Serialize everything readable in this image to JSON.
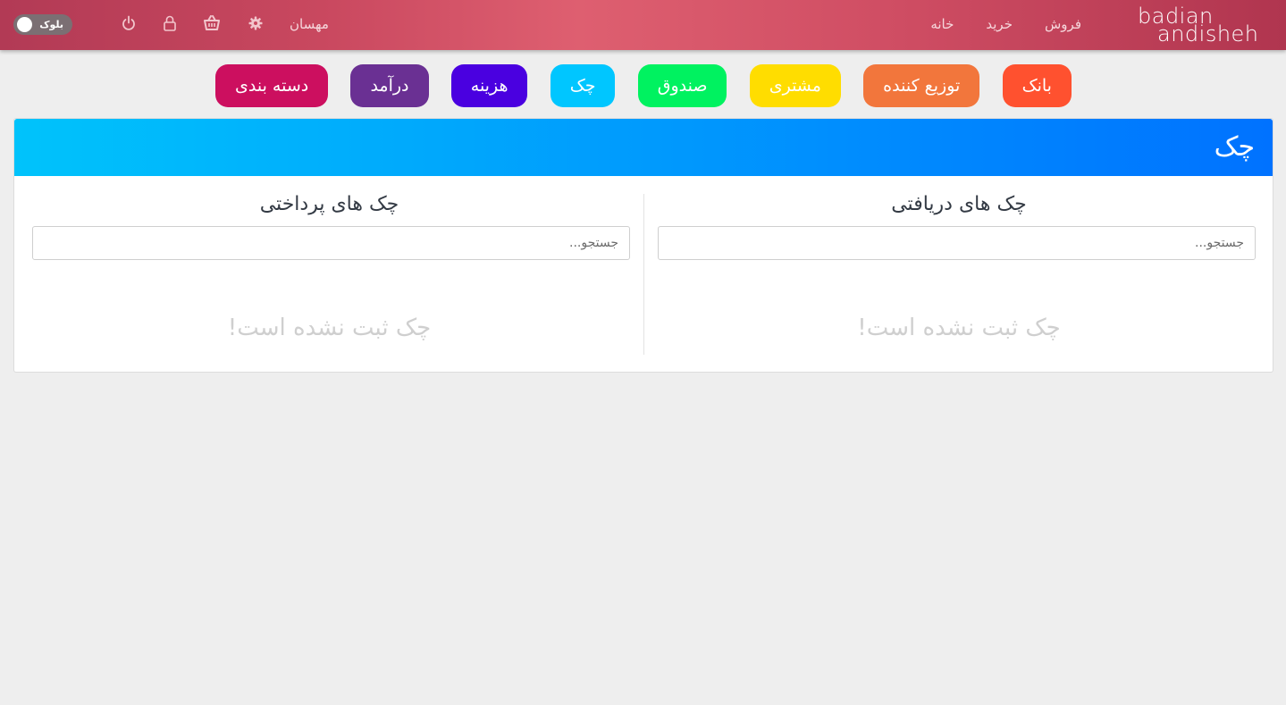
{
  "header": {
    "logo_line1": "badian",
    "logo_line2": "andisheh",
    "nav": [
      {
        "label": "خانه"
      },
      {
        "label": "خرید"
      },
      {
        "label": "فروش"
      }
    ],
    "guest_label": "مهسان",
    "icons": [
      "settings-gear-icon",
      "basket-icon",
      "lock-icon",
      "power-icon"
    ],
    "toggle_label": "بلوک"
  },
  "categories": [
    {
      "label": "بانک",
      "color": "#ff512f"
    },
    {
      "label": "توزیع کننده",
      "color": "#f2763c"
    },
    {
      "label": "مشتری",
      "color": "#ffdd00"
    },
    {
      "label": "صندوق",
      "color": "#00f260"
    },
    {
      "label": "چک",
      "color": "#00c6ff"
    },
    {
      "label": "هزینه",
      "color": "#4a00e0"
    },
    {
      "label": "درآمد",
      "color": "#6a3093"
    },
    {
      "label": "دسته بندی",
      "color": "#cc0f5f"
    }
  ],
  "card": {
    "title": "چک",
    "received": {
      "title": "چک های دریافتی",
      "search_placeholder": "جستجو...",
      "empty_text": "چک ثبت نشده است!"
    },
    "paid": {
      "title": "چک های پرداختی",
      "search_placeholder": "جستجو...",
      "empty_text": "چک ثبت نشده است!"
    }
  },
  "colors": {
    "header_gradient_start": "#b23a55",
    "header_gradient_mid": "#de5f70",
    "card_header_start": "#00c3fb",
    "card_header_end": "#0072ff"
  }
}
